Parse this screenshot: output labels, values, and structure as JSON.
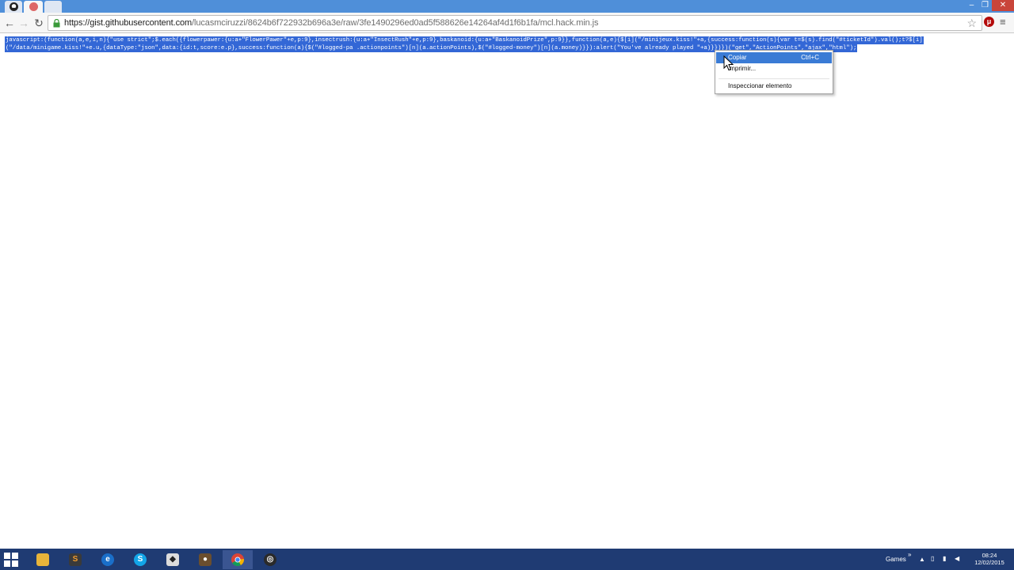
{
  "browser": {
    "tabs": [
      {
        "name": "github-tab",
        "active": true
      },
      {
        "name": "second-tab",
        "active": false
      }
    ],
    "url_host": "https://gist.githubusercontent.com",
    "url_path": "/lucasmciruzzi/8624b6f722932b696a3e/raw/3fe1490296ed0ad5f588626e14264af4d1f6b1fa/mcl.hack.min.js",
    "extension_label": "μ",
    "window_controls": {
      "minimize": "–",
      "restore": "❐",
      "close": "✕"
    }
  },
  "page": {
    "code_lines": [
      "javascript:(function(a,e,i,n){\"use strict\";$.each({flowerpawer:{u:a+\"FlowerPawer\"+e,p:9},insectrush:{u:a+\"InsectRush\"+e,p:9},baskanoid:{u:a+\"BaskanoidPrize\",p:9}},function(a,e){$[i](\"/minijeux.kiss!\"+a,{success:function(s){var t=$(s).find(\"#ticketId\").val();t?$[i]",
      "(\"/data/minigame.kiss!\"+e.u,{dataType:\"json\",data:{id:t,score:e.p},success:function(a){$(\"#logged-pa .actionpoints\")[n](a.actionPoints),$(\"#logged-money\")[n](a.money)}}):alert(\"You've already played \"+a)}})})(\"get\",\"ActionPoints\",\"ajax\",\"html\");"
    ]
  },
  "context_menu": {
    "items": [
      {
        "label": "Copiar",
        "shortcut": "Ctrl+C"
      },
      {
        "label": "Imprimir...",
        "shortcut": ""
      },
      {
        "label": "Inspeccionar elemento",
        "shortcut": ""
      }
    ]
  },
  "taskbar": {
    "toolbar_label": "Games",
    "overflow_label": "»",
    "clock_time": "08:24",
    "clock_date": "12/02/2015"
  },
  "colors": {
    "selection": "#3367d6",
    "taskbar": "#1f3b73",
    "titlebar": "#4f8fd9",
    "menu_hover": "#3a7bd5"
  }
}
